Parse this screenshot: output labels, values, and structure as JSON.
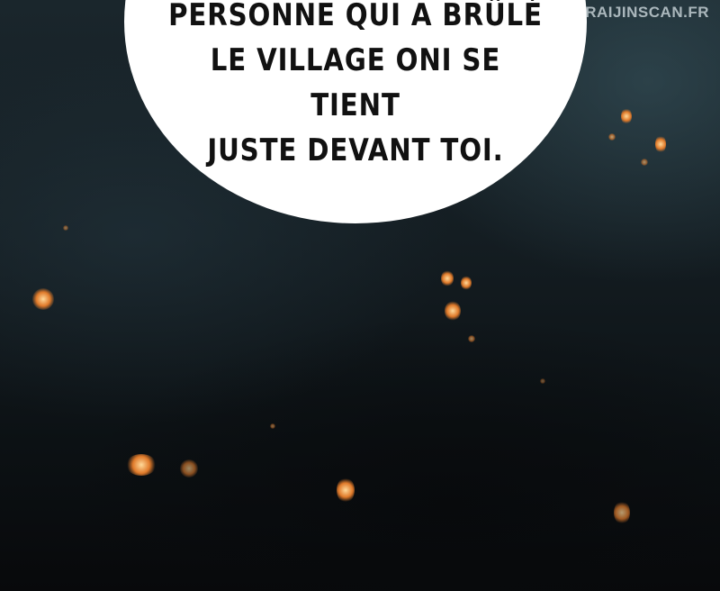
{
  "speech_bubble": {
    "lines": [
      "PERSONNE QUI A BRÛLÉ",
      "LE VILLAGE ONI SE TIENT",
      "JUSTE DEVANT TOI."
    ],
    "text_color": "#111111",
    "bubble_color": "#ffffff"
  },
  "watermark": "RAIJINSCAN.FR",
  "colors": {
    "background": "#0d1418",
    "ember": "#e07a2a"
  }
}
